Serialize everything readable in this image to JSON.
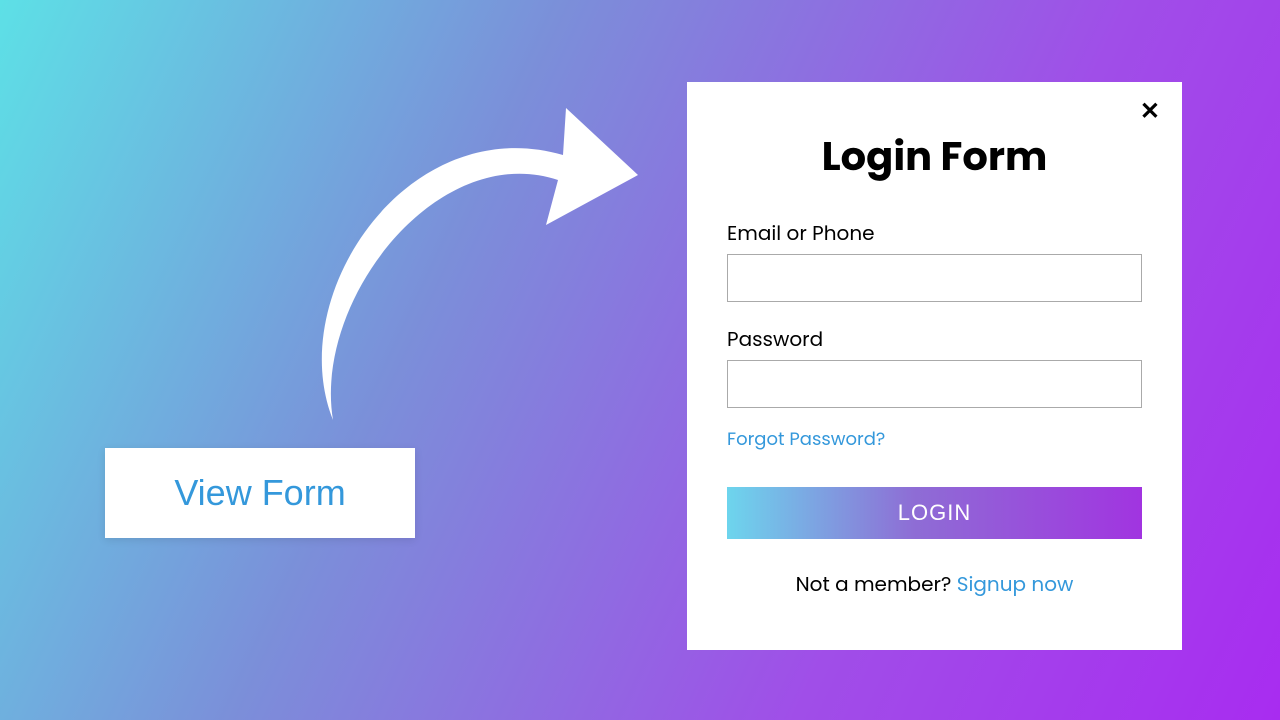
{
  "trigger": {
    "button_label": "View Form"
  },
  "modal": {
    "title": "Login Form",
    "email_label": "Email or Phone",
    "password_label": "Password",
    "forgot_link": "Forgot Password?",
    "login_button": "LOGIN",
    "signup_text": "Not a member? ",
    "signup_link": "Signup now"
  }
}
